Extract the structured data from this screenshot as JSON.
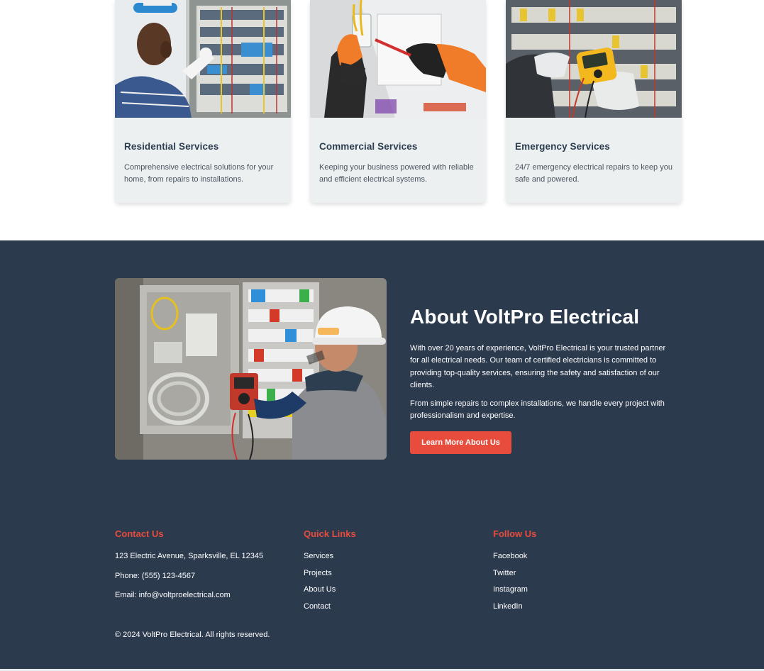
{
  "services": [
    {
      "title": "Residential Services",
      "description": "Comprehensive electrical solutions for your home, from repairs to installations."
    },
    {
      "title": "Commercial Services",
      "description": "Keeping your business powered with reliable and efficient electrical systems."
    },
    {
      "title": "Emergency Services",
      "description": "24/7 emergency electrical repairs to keep you safe and powered."
    }
  ],
  "about": {
    "title": "About VoltPro Electrical",
    "paragraph1": "With over 20 years of experience, VoltPro Electrical is your trusted partner for all electrical needs. Our team of certified electricians is committed to providing top-quality services, ensuring the safety and satisfaction of our clients.",
    "paragraph2": "From simple repairs to complex installations, we handle every project with professionalism and expertise.",
    "button_label": "Learn More About Us"
  },
  "footer": {
    "contact": {
      "heading": "Contact Us",
      "address": "123 Electric Avenue, Sparksville, EL 12345",
      "phone": "Phone: (555) 123-4567",
      "email": "Email: info@voltproelectrical.com"
    },
    "quick_links": {
      "heading": "Quick Links",
      "items": [
        "Services",
        "Projects",
        "About Us",
        "Contact"
      ]
    },
    "follow": {
      "heading": "Follow Us",
      "items": [
        "Facebook",
        "Twitter",
        "Instagram",
        "LinkedIn"
      ]
    },
    "copyright": "© 2024 VoltPro Electrical. All rights reserved."
  },
  "colors": {
    "accent": "#e74c3c",
    "dark_bg": "#2c3a4e",
    "card_bg": "#ecf0f1",
    "heading": "#2c3e50"
  }
}
